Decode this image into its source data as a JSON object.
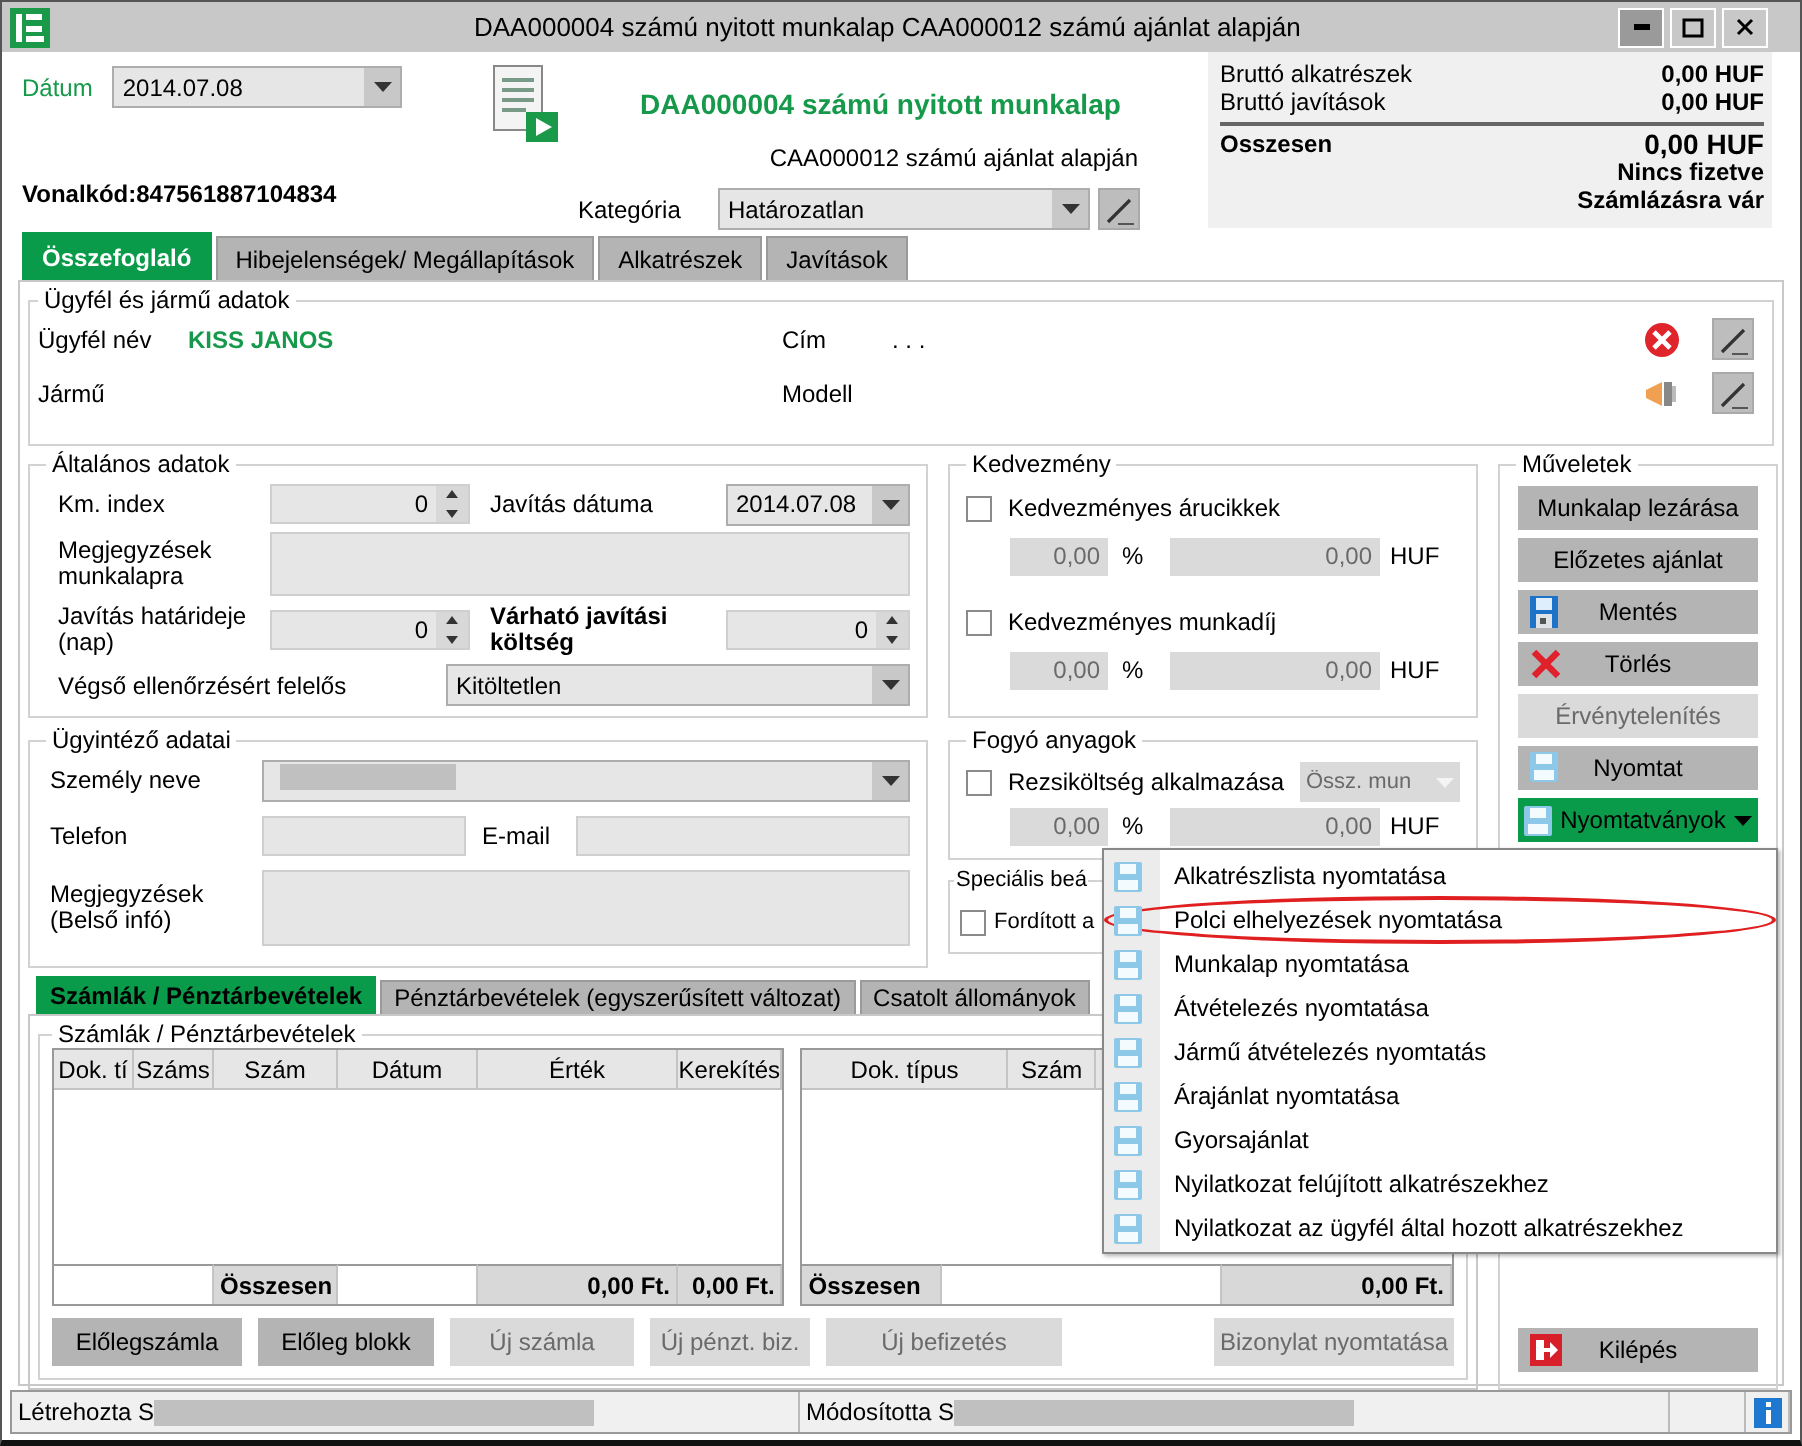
{
  "window": {
    "title": "DAA000004 számú nyitott munkalap CAA000012 számú ajánlat alapján"
  },
  "header": {
    "date_label": "Dátum",
    "date_value": "2014.07.08",
    "title": "DAA000004 számú nyitott munkalap",
    "subtitle": "CAA000012 számú ajánlat alapján",
    "barcode": "Vonalkód:847561887104834",
    "category_label": "Kategória",
    "category_value": "Határozatlan"
  },
  "summary": {
    "rows": [
      {
        "label": "Bruttó alkatrészek",
        "value": "0,00 HUF"
      },
      {
        "label": "Bruttó javítások",
        "value": "0,00 HUF"
      }
    ],
    "total_label": "Osszesen",
    "total_value": "0,00 HUF",
    "status_lines": [
      "Nincs fizetve",
      "Számlázásra vár"
    ]
  },
  "tabs": [
    {
      "label": "Összefoglaló",
      "selected": true
    },
    {
      "label": "Hibejelenségek/ Megállapítások",
      "selected": false
    },
    {
      "label": "Alkatrészek",
      "selected": false
    },
    {
      "label": "Javítások",
      "selected": false
    }
  ],
  "customer": {
    "title": "Ügyfél és jármű adatok",
    "name_label": "Ügyfél név",
    "name_value": "KISS JANOS",
    "vehicle_label": "Jármű",
    "address_label": "Cím",
    "address_value": ". . .",
    "model_label": "Modell"
  },
  "general": {
    "title": "Általános adatok",
    "km_label": "Km. index",
    "km_value": "0",
    "repair_date_label": "Javítás dátuma",
    "repair_date_value": "2014.07.08",
    "notes_label": "Megjegyzések munkalapra",
    "deadline_label": "Javítás határideje (nap)",
    "deadline_value": "0",
    "cost_label": "Várható javítási költség",
    "cost_value": "0",
    "inspector_label": "Végső ellenőrzésért felelős",
    "inspector_value": "Kitöltetlen"
  },
  "handler": {
    "title": "Ügyintéző adatai",
    "person_label": "Személy neve",
    "person_redacted": true,
    "phone_label": "Telefon",
    "email_label": "E-mail",
    "notes_label": "Megjegyzések (Belső infó)"
  },
  "discount": {
    "title": "Kedvezmény",
    "rows": [
      {
        "label": "Kedvezményes árucikkek",
        "checked": false,
        "percent": "0,00",
        "percent_unit": "%",
        "amount": "0,00",
        "currency": "HUF"
      },
      {
        "label": "Kedvezményes munkadíj",
        "checked": false,
        "percent": "0,00",
        "percent_unit": "%",
        "amount": "0,00",
        "currency": "HUF"
      }
    ]
  },
  "consumables": {
    "title": "Fogyó anyagok",
    "label": "Rezsiköltség alkalmazása",
    "checked": false,
    "mode": "Össz. mun",
    "percent": "0,00",
    "percent_unit": "%",
    "amount": "0,00",
    "currency": "HUF"
  },
  "special": {
    "title": "Speciális beá",
    "option_label": "Fordított a",
    "checked": false
  },
  "operations": {
    "title": "Műveletek",
    "buttons": [
      {
        "label": "Munkalap lezárása",
        "kind": "plain",
        "disabled": false
      },
      {
        "label": "Előzetes ajánlat",
        "kind": "plain",
        "disabled": false
      },
      {
        "label": "Mentés",
        "kind": "save",
        "disabled": false
      },
      {
        "label": "Törlés",
        "kind": "delete",
        "disabled": false
      },
      {
        "label": "Érvénytelenítés",
        "kind": "plain",
        "disabled": true
      },
      {
        "label": "Nyomtat",
        "kind": "print",
        "disabled": false
      },
      {
        "label": "Nyomtatványok",
        "kind": "menu",
        "disabled": false,
        "expanded": true
      }
    ],
    "exit_label": "Kilépés"
  },
  "print_menu": [
    {
      "label": "Alkatrészlista nyomtatása",
      "circled": false
    },
    {
      "label": "Polci elhelyezések nyomtatása",
      "circled": true
    },
    {
      "label": "Munkalap nyomtatása",
      "circled": false
    },
    {
      "label": "Átvételezés nyomtatása",
      "circled": false
    },
    {
      "label": "Jármű átvételezés nyomtatás",
      "circled": false
    },
    {
      "label": "Árajánlat nyomtatása",
      "circled": false
    },
    {
      "label": "Gyorsajánlat",
      "circled": false
    },
    {
      "label": "Nyilatkozat felújított alkatrészekhez",
      "circled": false
    },
    {
      "label": "Nyilatkozat az ügyfél által hozott alkatrészekhez",
      "circled": false
    }
  ],
  "bottom_tabs": [
    {
      "label": "Számlák / Pénztárbevételek",
      "selected": true
    },
    {
      "label": "Pénztárbevételek (egyszerűsített változat)",
      "selected": false
    },
    {
      "label": "Csatolt állományok",
      "selected": false
    }
  ],
  "invoices": {
    "title": "Számlák / Pénztárbevételek",
    "columns": [
      "Dok. tí",
      "Száms",
      "Szám",
      "Dátum",
      "Érték",
      "Kerekítés"
    ],
    "total_label": "Összesen",
    "total_value": "0,00 Ft.",
    "total_rounding": "0,00 Ft.",
    "right_columns": [
      "Dok. típus",
      "Szám"
    ],
    "right_total_label": "Összesen",
    "right_total_value": "0,00 Ft.",
    "buttons": [
      {
        "label": "Előlegszámla",
        "disabled": false
      },
      {
        "label": "Előleg blokk",
        "disabled": false
      },
      {
        "label": "Új számla",
        "disabled": true
      },
      {
        "label": "Új pénzt. biz.",
        "disabled": true
      },
      {
        "label": "Új befizetés",
        "disabled": true
      },
      {
        "label": "Bizonylat nyomtatása",
        "disabled": true
      }
    ]
  },
  "status_bar": {
    "created": "Létrehozta S",
    "created_redacted": true,
    "modified": "Módosította S",
    "modified_redacted": true
  }
}
